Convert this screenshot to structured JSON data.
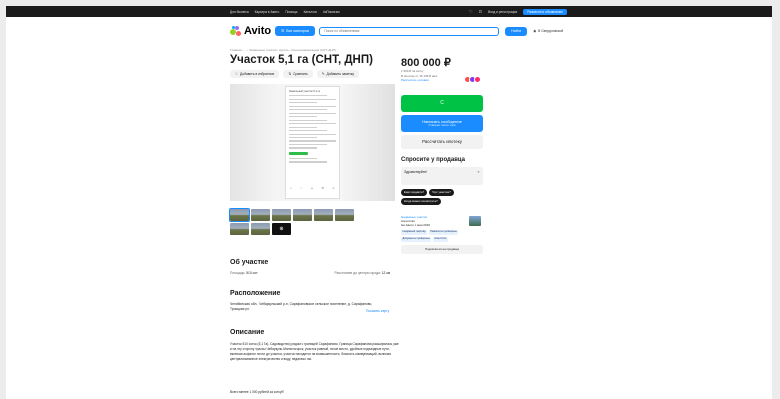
{
  "topbar": {
    "links": [
      "Для бизнеса",
      "Карьера в Авито",
      "Помощь",
      "Каталоги",
      "#яПомогаю"
    ],
    "login": "Вход и регистрация",
    "post_ad": "Разместить объявление"
  },
  "search": {
    "logo": "Avito",
    "categories_btn": "Все категории",
    "placeholder": "Поиск по объявлениям",
    "find_btn": "Найти",
    "region": "В Свердловской"
  },
  "breadcrumbs": "Главная › ... › Земельные участки › Купить › Сельхозназначения (СНТ, ДНП)",
  "title": "Участок 5,1 га (СНТ, ДНП)",
  "actions": {
    "favorite": "Добавить в избранное",
    "compare": "Сравнить",
    "note": "Добавить заметку"
  },
  "gallery": {
    "more_label": "⊕",
    "phone_header": "Земельный участок 5,1 га"
  },
  "about": {
    "heading": "Об участке",
    "area_label": "Площадь:",
    "area_value": "510 сот.",
    "distance_label": "Расстояние до центра города:",
    "distance_value": "12 км"
  },
  "location": {
    "heading": "Расположение",
    "address": "Челябинская обл., Чебаркульский р-н, Сарафановское сельское поселение, д. Сарафаново, Троицкая ул.",
    "show_map": "Показать карту"
  },
  "description": {
    "heading": "Описание",
    "text": "Участок 510 соток (5,1 Га). Садоводство) рядом с границей Сарафаново. Граница Сарафанова расширилась уже и на эту сторону трассы Чебаркуль-Магнитогорск, участок ровный, тихое место, удобные подъездные пути, включая асфальт почти до участка, участок находится на возвышенности, близость коммуникаций, включая централизованное электричество и воду, недалеко газ.",
    "extra": "Всего менее 1 000 рублей за сотку!!!"
  },
  "sidebar": {
    "price": "800 000 ₽",
    "per_unit": "1 569 ₽ за сотку",
    "mortgage": "В ипотеку от 15 195 ₽ мес.",
    "mortgage_link": "Рассчитать условия",
    "show_phone": "С",
    "message_btn": "Написать сообщение",
    "message_sub": "Отвечает около часа",
    "calc_btn": "Рассчитать ипотеку",
    "ask_heading": "Спросите у продавца",
    "ask_placeholder": "Здравствуйте!",
    "chips": [
      "Ещё продаёте?",
      "Торг уместен?",
      "Когда можно посмотреть?"
    ]
  },
  "seller": {
    "type": "Надёжные участки",
    "name": "Агентство",
    "since": "На Авито с мая 2019",
    "tags": [
      "Надёжный партнёр",
      "Реквизиты проверены",
      "Документы проверены",
      "Агентство"
    ],
    "subscribe": "Подписаться на продавца"
  }
}
